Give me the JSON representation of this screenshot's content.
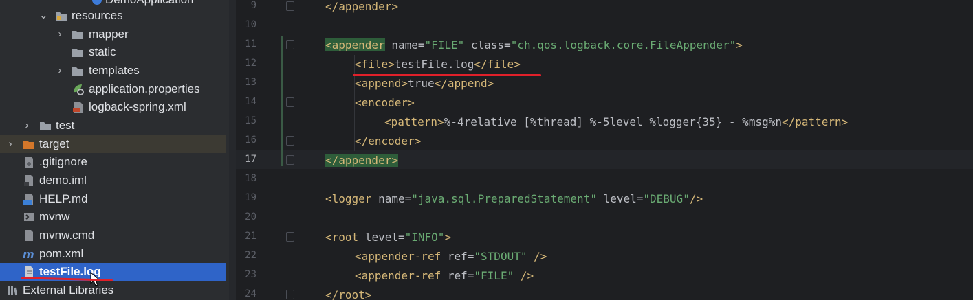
{
  "project_tree": {
    "items": [
      {
        "label": "DemoApplication",
        "kind": "class"
      },
      {
        "label": "resources",
        "kind": "folder-open"
      },
      {
        "label": "mapper",
        "kind": "folder"
      },
      {
        "label": "static",
        "kind": "folder"
      },
      {
        "label": "templates",
        "kind": "folder"
      },
      {
        "label": "application.properties",
        "kind": "properties"
      },
      {
        "label": "logback-spring.xml",
        "kind": "xml"
      },
      {
        "label": "test",
        "kind": "folder"
      },
      {
        "label": "target",
        "kind": "folder-excluded"
      },
      {
        "label": ".gitignore",
        "kind": "file"
      },
      {
        "label": "demo.iml",
        "kind": "iml"
      },
      {
        "label": "HELP.md",
        "kind": "md"
      },
      {
        "label": "mvnw",
        "kind": "shell"
      },
      {
        "label": "mvnw.cmd",
        "kind": "file"
      },
      {
        "label": "pom.xml",
        "kind": "maven"
      },
      {
        "label": "testFile.log",
        "kind": "log"
      },
      {
        "label": "External Libraries",
        "kind": "libraries"
      }
    ]
  },
  "editor": {
    "lines": [
      {
        "num": "9",
        "text": "</appender>"
      },
      {
        "num": "10",
        "text": ""
      },
      {
        "num": "11",
        "text": "<appender name=\"FILE\" class=\"ch.qos.logback.core.FileAppender\">"
      },
      {
        "num": "12",
        "text": "<file>testFile.log</file>"
      },
      {
        "num": "13",
        "text": "<append>true</append>"
      },
      {
        "num": "14",
        "text": "<encoder>"
      },
      {
        "num": "15",
        "text": "<pattern>%-4relative [%thread] %-5level %logger{35} - %msg%n</pattern>"
      },
      {
        "num": "16",
        "text": "</encoder>"
      },
      {
        "num": "17",
        "text": "</appender>"
      },
      {
        "num": "18",
        "text": ""
      },
      {
        "num": "19",
        "text": "<logger name=\"java.sql.PreparedStatement\" level=\"DEBUG\"/>"
      },
      {
        "num": "20",
        "text": ""
      },
      {
        "num": "21",
        "text": "<root level=\"INFO\">"
      },
      {
        "num": "22",
        "text": "<appender-ref ref=\"STDOUT\" />"
      },
      {
        "num": "23",
        "text": "<appender-ref ref=\"FILE\" />"
      },
      {
        "num": "24",
        "text": "</root>"
      }
    ]
  },
  "colors": {
    "selection": "#2f64c8",
    "annotation": "#e0202a",
    "xml_tag": "#d5b778",
    "xml_value": "#6aab73"
  }
}
